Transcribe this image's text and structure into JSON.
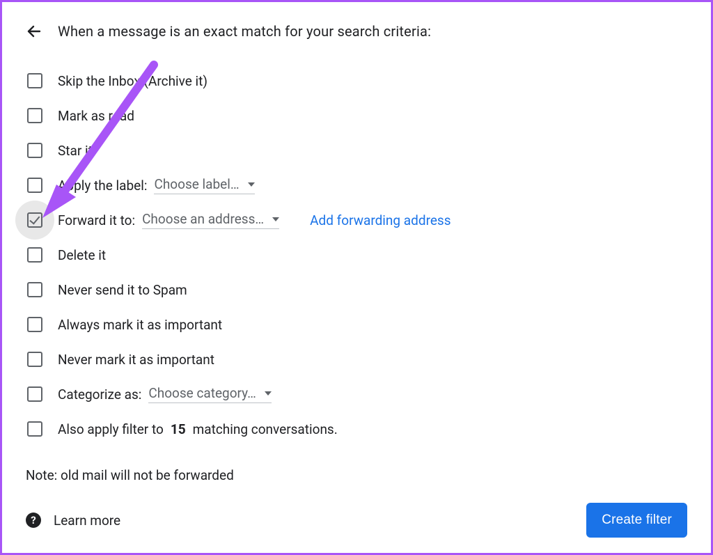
{
  "header": "When a message is an exact match for your search criteria:",
  "options": {
    "skip_inbox": "Skip the Inbox (Archive it)",
    "mark_read": "Mark as read",
    "star_it": "Star it",
    "apply_label_prefix": "Apply the label:",
    "apply_label_dropdown": "Choose label…",
    "forward_to_prefix": "Forward it to:",
    "forward_to_dropdown": "Choose an address…",
    "forward_link": "Add forwarding address",
    "delete_it": "Delete it",
    "never_spam": "Never send it to Spam",
    "always_important": "Always mark it as important",
    "never_important": "Never mark it as important",
    "categorize_prefix": "Categorize as:",
    "categorize_dropdown": "Choose category…",
    "also_apply_prefix": "Also apply filter to",
    "also_apply_count": "15",
    "also_apply_suffix": "matching conversations."
  },
  "note": "Note: old mail will not be forwarded",
  "learn_more": "Learn more",
  "create_button": "Create filter"
}
